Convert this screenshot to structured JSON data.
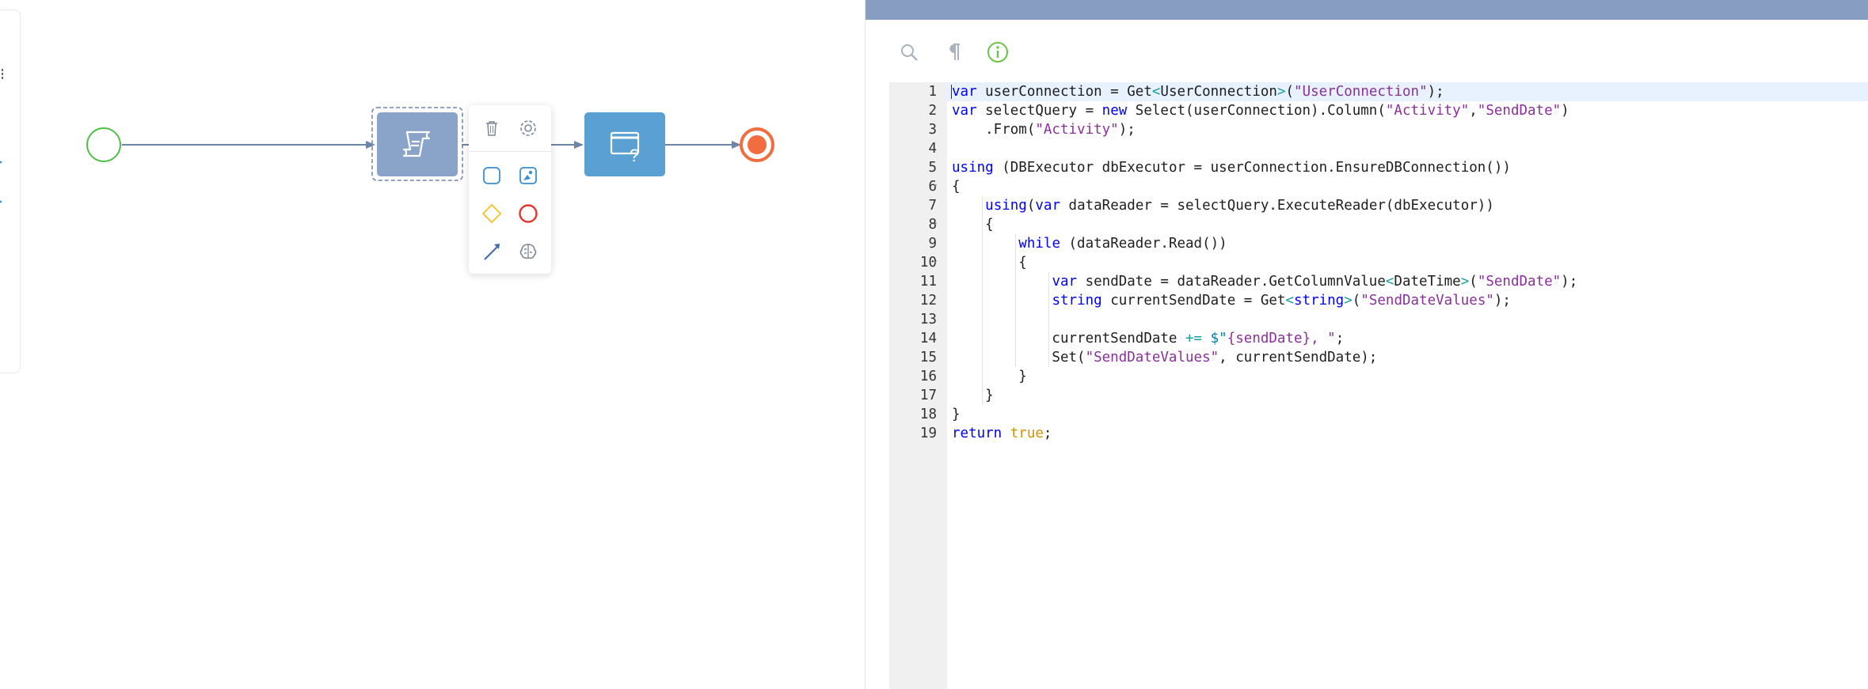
{
  "diagram": {
    "palette_icons": [
      "task-icon",
      "user-task-icon",
      "start-event-icon",
      "intermediate-event-icon",
      "end-event-icon",
      "gateway-icon"
    ],
    "nodes": [
      {
        "id": "start-event",
        "type": "start",
        "color": "#4cbf45"
      },
      {
        "id": "script-task",
        "type": "script",
        "color": "#8aa3c8",
        "icon": "scroll-script-icon"
      },
      {
        "id": "user-dialog-task",
        "type": "dialog",
        "color": "#5aa0d2",
        "icon": "dialog-question-icon"
      },
      {
        "id": "end-event",
        "type": "end",
        "color": "#f26d3d"
      }
    ],
    "context_menu": [
      "trash-icon",
      "gear-icon",
      "task-shape-icon",
      "image-task-icon",
      "gateway-diamond-icon",
      "end-circle-icon",
      "connector-arrow-icon",
      "ai-brain-icon"
    ]
  },
  "toolbar": {
    "buttons": [
      "search-icon",
      "pilcrow-icon",
      "info-icon"
    ],
    "colors": {
      "search": "#a9b3bd",
      "pilcrow": "#a9b3bd",
      "info": "#6cc24a"
    }
  },
  "editor": {
    "line_numbers": [
      "1",
      "2",
      "3",
      "4",
      "5",
      "6",
      "7",
      "8",
      "9",
      "10",
      "11",
      "12",
      "13",
      "14",
      "15",
      "16",
      "17",
      "18",
      "19"
    ],
    "lines": [
      {
        "p": [
          [
            "var",
            "kw"
          ],
          [
            " userConnection = Get",
            ""
          ],
          [
            "<",
            "lt"
          ],
          [
            "UserConnection",
            ""
          ],
          [
            ">",
            "lt"
          ],
          [
            "(",
            ""
          ],
          [
            "\"UserConnection\"",
            "s2"
          ],
          [
            ");",
            ""
          ]
        ]
      },
      {
        "p": [
          [
            "var",
            "kw"
          ],
          [
            " selectQuery = ",
            ""
          ],
          [
            "new",
            "kw"
          ],
          [
            " Select(userConnection).Column(",
            ""
          ],
          [
            "\"Activity\"",
            "s2"
          ],
          [
            ",",
            ""
          ],
          [
            "\"SendDate\"",
            "s2"
          ],
          [
            ")",
            ""
          ]
        ]
      },
      {
        "p": [
          [
            "    .From(",
            ""
          ],
          [
            "\"Activity\"",
            "s2"
          ],
          [
            ");",
            ""
          ]
        ]
      },
      {
        "p": []
      },
      {
        "p": [
          [
            "using",
            "kw"
          ],
          [
            " (DBExecutor dbExecutor = userConnection.EnsureDBConnection())",
            ""
          ]
        ]
      },
      {
        "p": [
          [
            "{",
            ""
          ]
        ]
      },
      {
        "p": [
          [
            "    ",
            ""
          ],
          [
            "using",
            "kw"
          ],
          [
            "(",
            ""
          ],
          [
            "var",
            "kw"
          ],
          [
            " dataReader = selectQuery.ExecuteReader(dbExecutor))",
            ""
          ]
        ]
      },
      {
        "p": [
          [
            "    {",
            ""
          ]
        ]
      },
      {
        "p": [
          [
            "        ",
            ""
          ],
          [
            "while",
            "kw"
          ],
          [
            " (dataReader.Read())",
            ""
          ]
        ]
      },
      {
        "p": [
          [
            "        {",
            ""
          ]
        ]
      },
      {
        "p": [
          [
            "            ",
            ""
          ],
          [
            "var",
            "kw"
          ],
          [
            " sendDate = dataReader.GetColumnValue",
            ""
          ],
          [
            "<",
            "lt"
          ],
          [
            "DateTime",
            ""
          ],
          [
            ">",
            "lt"
          ],
          [
            "(",
            ""
          ],
          [
            "\"SendDate\"",
            "s2"
          ],
          [
            ");",
            ""
          ]
        ]
      },
      {
        "p": [
          [
            "            ",
            ""
          ],
          [
            "string",
            "kw"
          ],
          [
            " currentSendDate = Get",
            ""
          ],
          [
            "<",
            "lt"
          ],
          [
            "string",
            "kw"
          ],
          [
            ">",
            "lt"
          ],
          [
            "(",
            ""
          ],
          [
            "\"SendDateValues\"",
            "s2"
          ],
          [
            ");",
            ""
          ]
        ]
      },
      {
        "p": []
      },
      {
        "p": [
          [
            "            currentSendDate ",
            ""
          ],
          [
            "+=",
            "lt"
          ],
          [
            " ",
            ""
          ],
          [
            "$\"",
            "interp"
          ],
          [
            "{sendDate}, ",
            "s2"
          ],
          [
            "\"",
            "s2"
          ],
          [
            ";",
            ""
          ]
        ]
      },
      {
        "p": [
          [
            "            Set(",
            ""
          ],
          [
            "\"SendDateValues\"",
            "s2"
          ],
          [
            ", currentSendDate);",
            ""
          ]
        ]
      },
      {
        "p": [
          [
            "        }",
            ""
          ]
        ]
      },
      {
        "p": [
          [
            "    }",
            ""
          ]
        ]
      },
      {
        "p": [
          [
            "}",
            ""
          ]
        ]
      },
      {
        "p": [
          [
            "return",
            "kw"
          ],
          [
            " ",
            ""
          ],
          [
            "true",
            "lit"
          ],
          [
            ";",
            ""
          ]
        ]
      }
    ],
    "folded_lines": [
      6,
      8,
      10
    ],
    "active_line": 1
  }
}
